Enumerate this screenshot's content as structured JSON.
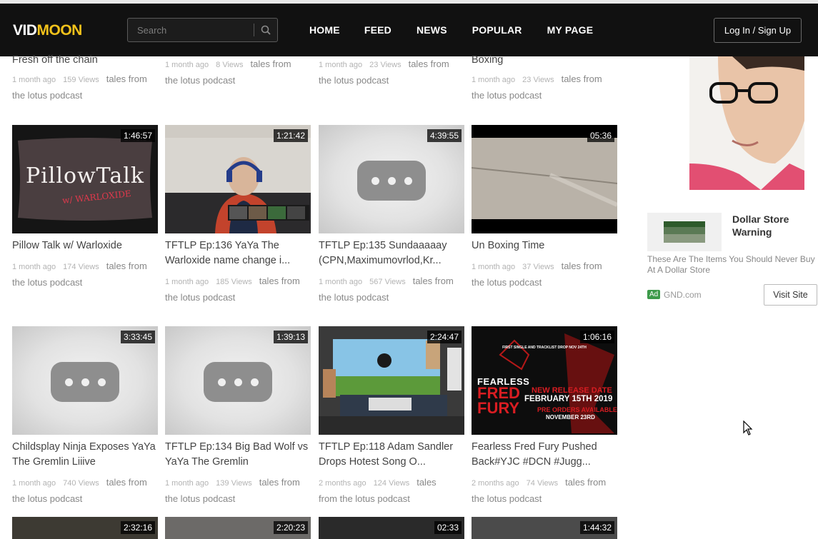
{
  "brand": {
    "left": "VID",
    "mid": "MOON",
    "accent": "#f2c21b"
  },
  "search": {
    "placeholder": "Search"
  },
  "nav": [
    "HOME",
    "FEED",
    "NEWS",
    "POPULAR",
    "MY PAGE"
  ],
  "auth": {
    "login_label": "Log In / Sign Up"
  },
  "top_partial": [
    {
      "title": "Fresh off the chain",
      "age": "1 month ago",
      "views": "159 Views",
      "channel_a": "tales from",
      "channel_b": "the lotus podcast"
    },
    {
      "title": "",
      "age": "1 month ago",
      "views": "8 Views",
      "channel_a": "tales from",
      "channel_b": "the lotus podcast"
    },
    {
      "title": "",
      "age": "1 month ago",
      "views": "23 Views",
      "channel_a": "tales from",
      "channel_b": "the lotus podcast"
    },
    {
      "title": "Boxing",
      "age": "1 month ago",
      "views": "23 Views",
      "channel_a": "tales from",
      "channel_b": "the lotus podcast"
    }
  ],
  "row1": [
    {
      "duration": "1:46:57",
      "title": "Pillow Talk w/ Warloxide",
      "age": "1 month ago",
      "views": "174 Views",
      "channel_a": "tales from",
      "channel_b": "the lotus podcast",
      "thumb_text": "PillowTalk",
      "thumb_sub": "w/ WARLOXIDE"
    },
    {
      "duration": "1:21:42",
      "title": "TFTLP Ep:136 YaYa The Warloxide name change i...",
      "age": "1 month ago",
      "views": "185 Views",
      "channel_a": "tales from",
      "channel_b": "the lotus podcast"
    },
    {
      "duration": "4:39:55",
      "title": "TFTLP Ep:135 Sundaaaaay (CPN,Maximumovrlod,Kr...",
      "age": "1 month ago",
      "views": "567 Views",
      "channel_a": "tales from",
      "channel_b": "the lotus podcast"
    },
    {
      "duration": "05:36",
      "title": "Un Boxing Time",
      "age": "1 month ago",
      "views": "37 Views",
      "channel_a": "tales from",
      "channel_b": "the lotus podcast"
    }
  ],
  "row2": [
    {
      "duration": "3:33:45",
      "title": "Childsplay Ninja Exposes YaYa The Gremlin Liiive",
      "age": "1 month ago",
      "views": "740 Views",
      "channel_a": "tales from",
      "channel_b": "the lotus podcast"
    },
    {
      "duration": "1:39:13",
      "title": "TFTLP Ep:134 Big Bad Wolf vs YaYa The Gremlin",
      "age": "1 month ago",
      "views": "139 Views",
      "channel_a": "tales from",
      "channel_b": "the lotus podcast"
    },
    {
      "duration": "2:24:47",
      "title": "TFTLP Ep:118 Adam Sandler Drops Hotest Song O...",
      "age": "2 months ago",
      "views": "124 Views",
      "channel_a": "tales",
      "channel_b": "from the lotus podcast"
    },
    {
      "duration": "1:06:16",
      "title": "Fearless Fred Fury Pushed Back#YJC #DCN #Jugg...",
      "age": "2 months ago",
      "views": "74 Views",
      "channel_a": "tales from",
      "channel_b": "the lotus podcast",
      "poster_top": "FIRST SINGLE AND TRACKLIST DROP NOV 24TH",
      "poster_name1": "FEARLESS",
      "poster_name2": "FRED",
      "poster_name3": "FURY",
      "poster_release": "NEW RELEASE DATE",
      "poster_date": "FEBRUARY 15TH 2019",
      "poster_preorder": "PRE ORDERS AVAILABLE",
      "poster_nov": "NOVEMBER 23RD"
    }
  ],
  "row3_durations": [
    "2:32:16",
    "2:20:23",
    "02:33",
    "1:44:32"
  ],
  "ad": {
    "title": "Dollar Store Warning",
    "description": "These Are The Items You Should Never Buy At A Dollar Store",
    "badge": "Ad",
    "domain": "GND.com",
    "cta": "Visit Site"
  }
}
